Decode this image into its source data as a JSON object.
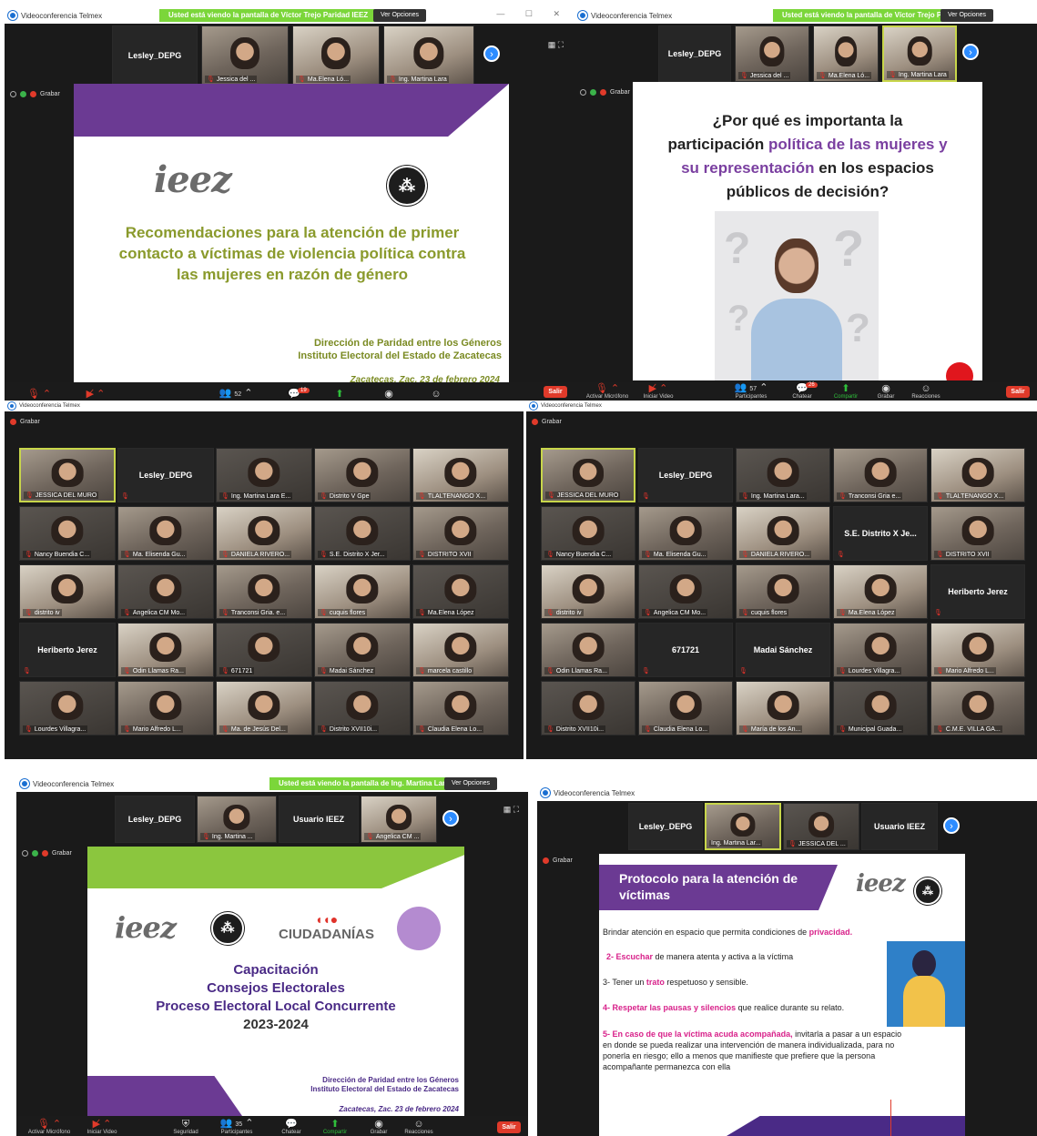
{
  "app_title": "Videoconferencia Telmex",
  "colors": {
    "accent_blue": "#2d8cff",
    "zoom_green": "#7bd63a",
    "mute_red": "#e03a2a",
    "slide_purple": "#7a3fa0",
    "slide_olive": "#8a9a2c"
  },
  "panel1": {
    "banner": "Usted está viendo la pantalla de Víctor Trejo Paridad IEEZ",
    "view_options": "Ver Opciones",
    "strip": [
      {
        "name": "Lesley_DEPG"
      },
      {
        "name": "Jessica del ..."
      },
      {
        "name": "Ma.Elena Ló..."
      },
      {
        "name": "Ing. Martina Lara"
      }
    ],
    "grabar": "Grabar",
    "slide": {
      "logo": "ieez",
      "title": "Recomendaciones para la atención de primer contacto a víctimas de violencia política contra las mujeres en razón de género",
      "dept": "Dirección de Paridad entre los Géneros",
      "inst": "Instituto Electoral del Estado de Zacatecas",
      "place": "Zacatecas, Zac. 23 de febrero 2024"
    },
    "toolbar": {
      "participants_count": "52",
      "chat_badge": "19"
    }
  },
  "panel2": {
    "banner": "Usted está viendo la pantalla de Víctor Trejo Paridad IEEZ",
    "view_options": "Ver Opciones",
    "strip": [
      {
        "name": "Lesley_DEPG"
      },
      {
        "name": "Jessica del ..."
      },
      {
        "name": "Ma.Elena Ló..."
      },
      {
        "name": "Ing. Martina Lara"
      }
    ],
    "grabar": "Grabar",
    "slide": {
      "q1": "¿Por qué es importanta la",
      "q2a": "participación ",
      "q2b": "política de las mujeres y",
      "q3a": "su representación",
      "q3b": " en los espacios",
      "q4": "públicos de decisión?"
    },
    "toolbar": {
      "mic": "Activar Micrófono",
      "video": "Iniciar Video",
      "participants": "Participantes",
      "participants_count": "57",
      "chat": "Chatear",
      "chat_badge": "26",
      "share": "Compartir",
      "record": "Grabar",
      "reactions": "Reacciones",
      "leave": "Salir"
    }
  },
  "panel3": {
    "grabar": "Grabar",
    "tiles": [
      {
        "name": "JESSICA DEL MURO",
        "type": "video",
        "active": true
      },
      {
        "name": "Lesley_DEPG",
        "type": "name"
      },
      {
        "name": "Ing. Martina Lara E...",
        "type": "video"
      },
      {
        "name": "Distrito V Gpe",
        "type": "video"
      },
      {
        "name": "TLALTENANGO X...",
        "type": "video"
      },
      {
        "name": "Nancy Buendia C...",
        "type": "video"
      },
      {
        "name": "Ma. Elisenda Gu...",
        "type": "video"
      },
      {
        "name": "DANIELA RIVERO...",
        "type": "video"
      },
      {
        "name": "S.E. Distrito X Jer...",
        "type": "video"
      },
      {
        "name": "DISTRITO XVII",
        "type": "video"
      },
      {
        "name": "distrito iv",
        "type": "video"
      },
      {
        "name": "Angelica CM Mo...",
        "type": "video"
      },
      {
        "name": "Tranconsi Gria. e...",
        "type": "video"
      },
      {
        "name": "cuquis flores",
        "type": "video"
      },
      {
        "name": "Ma.Elena López",
        "type": "video"
      },
      {
        "name": "Heriberto Jerez",
        "type": "name"
      },
      {
        "name": "Odin Llamas Ra...",
        "type": "video"
      },
      {
        "name": "671721",
        "type": "video"
      },
      {
        "name": "Madai Sánchez",
        "type": "video"
      },
      {
        "name": "marcela castillo",
        "type": "video"
      },
      {
        "name": "Lourdes Villagra...",
        "type": "video"
      },
      {
        "name": "Mario Alfredo L...",
        "type": "video"
      },
      {
        "name": "Ma. de Jesús Del...",
        "type": "video"
      },
      {
        "name": "Distrito XVII10i...",
        "type": "video"
      },
      {
        "name": "Claudia Elena Lo...",
        "type": "video"
      }
    ]
  },
  "panel4": {
    "grabar": "Grabar",
    "tiles": [
      {
        "name": "JESSICA DEL MURO",
        "type": "video",
        "active": true
      },
      {
        "name": "Lesley_DEPG",
        "type": "name"
      },
      {
        "name": "Ing. Martina Lara...",
        "type": "video"
      },
      {
        "name": "Tranconsi Gria e...",
        "type": "video"
      },
      {
        "name": "TLALTENANGO X...",
        "type": "video"
      },
      {
        "name": "Nancy Buendia C...",
        "type": "video"
      },
      {
        "name": "Ma. Elisenda Gu...",
        "type": "video"
      },
      {
        "name": "DANIELA RIVERO...",
        "type": "video"
      },
      {
        "name": "S.E. Distrito X Je...",
        "type": "name"
      },
      {
        "name": "DISTRITO XVII",
        "type": "video"
      },
      {
        "name": "distrito iv",
        "type": "video"
      },
      {
        "name": "Angelica CM Mo...",
        "type": "video"
      },
      {
        "name": "cuquis flores",
        "type": "video"
      },
      {
        "name": "Ma.Elena López",
        "type": "video"
      },
      {
        "name": "Heriberto Jerez",
        "type": "name"
      },
      {
        "name": "Odin Llamas Ra...",
        "type": "video"
      },
      {
        "name": "671721",
        "type": "name"
      },
      {
        "name": "Madai Sánchez",
        "type": "name"
      },
      {
        "name": "Lourdes Villagra...",
        "type": "video"
      },
      {
        "name": "Mario Alfredo L...",
        "type": "video"
      },
      {
        "name": "Distrito XVII10i...",
        "type": "video"
      },
      {
        "name": "Claudia Elena Lo...",
        "type": "video"
      },
      {
        "name": "María de los An...",
        "type": "video"
      },
      {
        "name": "Municipal Guada...",
        "type": "video"
      },
      {
        "name": "C.M.E. VILLA GA...",
        "type": "video"
      }
    ]
  },
  "panel5": {
    "banner": "Usted está viendo la pantalla de Ing. Martina Lara IEEZ",
    "view_options": "Ver Opciones",
    "strip": [
      {
        "name": "Lesley_DEPG"
      },
      {
        "name": "Ing. Martina ..."
      },
      {
        "name": "Usuario IEEZ"
      },
      {
        "name": "Angelica CM ..."
      }
    ],
    "grabar": "Grabar",
    "slide": {
      "ciudadanias": "CIUDADANÍAS",
      "l1": "Capacitación",
      "l2": "Consejos Electorales",
      "l3": "Proceso Electoral Local Concurrente",
      "l4": "2023-2024",
      "dept": "Dirección de Paridad entre los Géneros",
      "inst": "Instituto Electoral del Estado de Zacatecas",
      "place": "Zacatecas, Zac. 23 de febrero 2024"
    },
    "toolbar": {
      "mic": "Activar Micrófono",
      "video": "Iniciar Video",
      "security": "Seguridad",
      "participants": "Participantes",
      "participants_count": "35",
      "chat": "Chatear",
      "share": "Compartir",
      "record": "Grabar",
      "reactions": "Reacciones",
      "leave": "Salir"
    }
  },
  "panel6": {
    "strip": [
      {
        "name": "Lesley_DEPG"
      },
      {
        "name": "Ing. Martina Lar..."
      },
      {
        "name": "JESSICA DEL ..."
      },
      {
        "name": "Usuario IEEZ"
      }
    ],
    "grabar": "Grabar",
    "slide": {
      "title": "Protocolo para la atención de víctimas",
      "i1a": "Brindar atención en espacio que permita condiciones de ",
      "i1b": "privacidad.",
      "i2a": "2- Escuchar",
      "i2b": " de manera atenta y activa a la víctima",
      "i3a": "3- Tener un ",
      "i3b": "trato",
      "i3c": " respetuoso y sensible.",
      "i4a": "4- Respetar las pausas y silencios",
      "i4b": " que realice durante su relato.",
      "i5a": "5- En caso de que la víctima acuda acompañada,",
      "i5b": " invitarla a pasar a un espacio en donde se pueda realizar una intervención de manera individualizada, para no ponerla en riesgo; ello a menos que manifieste que prefiere que la persona acompañante permanezca con ella"
    }
  }
}
